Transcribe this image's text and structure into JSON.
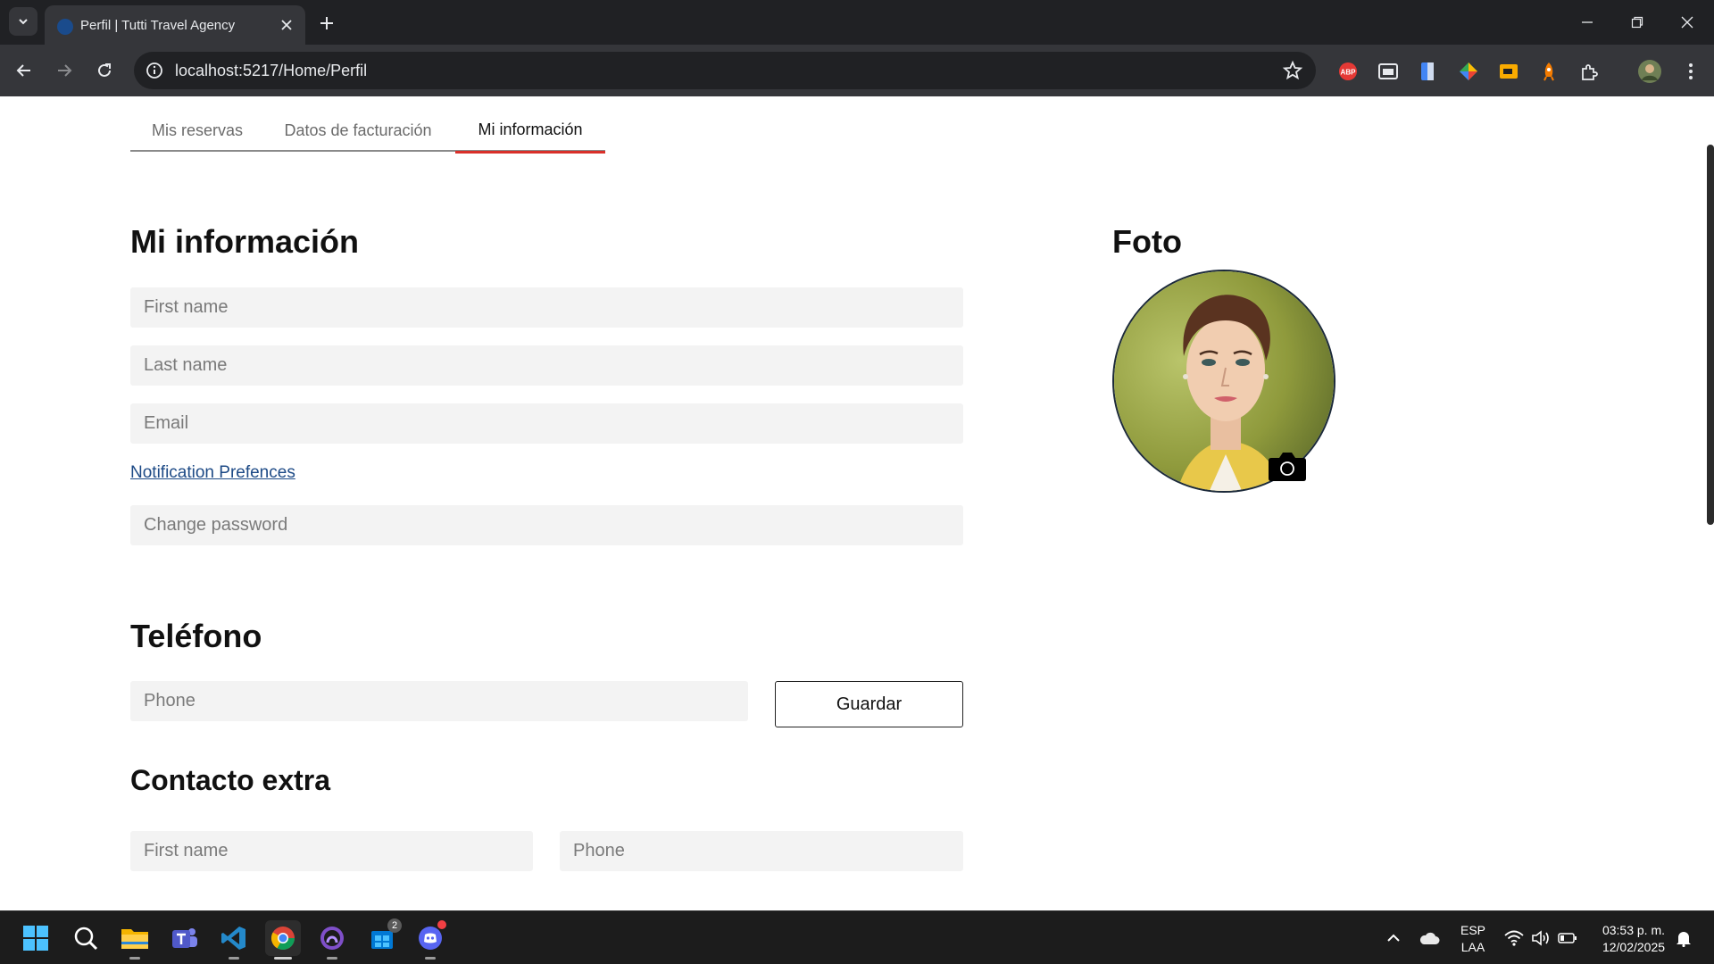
{
  "browser": {
    "tab_title": "Perfil | Tutti Travel Agency",
    "url": "localhost:5217/Home/Perfil",
    "extensions": [
      "adblock-plus-icon",
      "picture-in-picture-icon",
      "docs-icon",
      "color-picker-icon",
      "slides-icon",
      "rocket-icon",
      "extensions-puzzle-icon",
      "profile-avatar-icon"
    ]
  },
  "subnav": {
    "tabs": [
      "Mis reservas",
      "Datos de facturación",
      "Mi información"
    ],
    "active_index": 2
  },
  "info_section": {
    "title": "Mi información",
    "first_name_placeholder": "First name",
    "last_name_placeholder": "Last name",
    "email_placeholder": "Email",
    "notification_link": "Notification Prefences",
    "password_placeholder": "Change password"
  },
  "photo_section": {
    "title": "Foto",
    "camera_icon": "camera-icon"
  },
  "phone_section": {
    "title": "Teléfono",
    "phone_placeholder": "Phone",
    "save_label": "Guardar"
  },
  "extra_contact": {
    "title": "Contacto extra",
    "first_name_placeholder": "First name",
    "phone_placeholder": "Phone"
  },
  "taskbar": {
    "apps": [
      "windows-start-icon",
      "search-icon",
      "file-explorer-icon",
      "teams-icon",
      "vscode-icon",
      "chrome-icon",
      "github-desktop-icon",
      "store-icon",
      "discord-icon"
    ],
    "store_badge": "2",
    "language_top": "ESP",
    "language_bottom": "LAA",
    "time": "03:53 p. m.",
    "date": "12/02/2025"
  },
  "colors": {
    "accent_red": "#d9302a",
    "link_blue": "#1d4a86",
    "field_bg": "#f3f3f3"
  }
}
